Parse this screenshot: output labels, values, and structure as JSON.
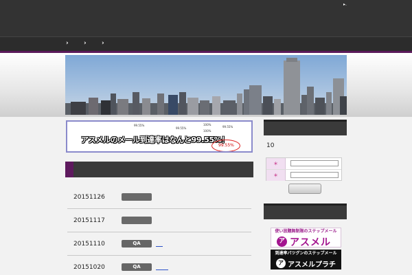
{
  "topbar": {
    "marker": "▸."
  },
  "nav": {
    "items": [
      "›",
      "›",
      "›"
    ]
  },
  "banner": {
    "headline": "アスメルのメール到達率はなんと99.55%！",
    "highlight": "99.55%",
    "cells": [
      "99.55%",
      "99.55%",
      "99.55%",
      "100%",
      "100%"
    ]
  },
  "news": {
    "rows": [
      {
        "date": "20151126",
        "badge": ""
      },
      {
        "date": "20151117",
        "badge": ""
      },
      {
        "date": "20151110",
        "badge": "QA"
      },
      {
        "date": "20151020",
        "badge": "QA"
      }
    ]
  },
  "sidebar": {
    "count": "10",
    "login": {
      "star1": "＊",
      "star2": "＊"
    }
  },
  "ads": {
    "asmel": {
      "tagline": "使い放題無制限のステップメール",
      "name": "アスメル",
      "logo": "ア"
    },
    "platina": {
      "tagline": "到達率バツグンのステップメール",
      "name": "アスメルプラチナ",
      "logo": "ア"
    }
  },
  "colors": {
    "accent": "#5e1a5e",
    "dark": "#333333",
    "brand": "#a3138f"
  }
}
